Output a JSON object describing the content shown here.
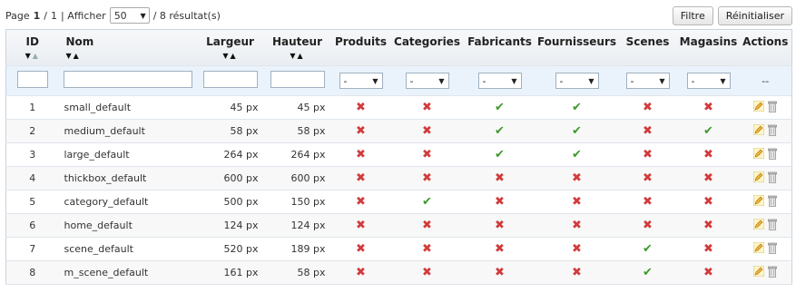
{
  "toolbar": {
    "page_label": "Page",
    "page_current": "1",
    "page_sep": "/",
    "page_total": "1",
    "show_label": "| Afficher",
    "per_page": "50",
    "results": "/ 8 résultat(s)",
    "filter_button": "Filtre",
    "reset_button": "Réinitialiser"
  },
  "columns": {
    "id": "ID",
    "name": "Nom",
    "width": "Largeur",
    "height": "Hauteur",
    "products": "Produits",
    "categories": "Categories",
    "manufacturers": "Fabricants",
    "suppliers": "Fournisseurs",
    "scenes": "Scenes",
    "stores": "Magasins",
    "actions": "Actions"
  },
  "filters": {
    "select_default": "-",
    "actions_placeholder": "--"
  },
  "rows": [
    {
      "id": "1",
      "name": "small_default",
      "width": "45 px",
      "height": "45 px",
      "products": false,
      "categories": false,
      "manufacturers": true,
      "suppliers": true,
      "scenes": false,
      "stores": false
    },
    {
      "id": "2",
      "name": "medium_default",
      "width": "58 px",
      "height": "58 px",
      "products": false,
      "categories": false,
      "manufacturers": true,
      "suppliers": true,
      "scenes": false,
      "stores": true
    },
    {
      "id": "3",
      "name": "large_default",
      "width": "264 px",
      "height": "264 px",
      "products": false,
      "categories": false,
      "manufacturers": true,
      "suppliers": true,
      "scenes": false,
      "stores": false
    },
    {
      "id": "4",
      "name": "thickbox_default",
      "width": "600 px",
      "height": "600 px",
      "products": false,
      "categories": false,
      "manufacturers": false,
      "suppliers": false,
      "scenes": false,
      "stores": false
    },
    {
      "id": "5",
      "name": "category_default",
      "width": "500 px",
      "height": "150 px",
      "products": false,
      "categories": true,
      "manufacturers": false,
      "suppliers": false,
      "scenes": false,
      "stores": false
    },
    {
      "id": "6",
      "name": "home_default",
      "width": "124 px",
      "height": "124 px",
      "products": false,
      "categories": false,
      "manufacturers": false,
      "suppliers": false,
      "scenes": false,
      "stores": false
    },
    {
      "id": "7",
      "name": "scene_default",
      "width": "520 px",
      "height": "189 px",
      "products": false,
      "categories": false,
      "manufacturers": false,
      "suppliers": false,
      "scenes": true,
      "stores": false
    },
    {
      "id": "8",
      "name": "m_scene_default",
      "width": "161 px",
      "height": "58 px",
      "products": false,
      "categories": false,
      "manufacturers": false,
      "suppliers": false,
      "scenes": true,
      "stores": false
    }
  ],
  "icons": {
    "yes": "check-icon",
    "no": "cross-icon",
    "edit": "pencil-icon",
    "delete": "trash-icon",
    "sort_desc": "sort-desc-icon",
    "sort_asc": "sort-asc-icon"
  },
  "colors": {
    "yes": "#3d9a2b",
    "no": "#d23b3b",
    "filter_row": "#eaf3fb",
    "header": "#e9edf1"
  }
}
